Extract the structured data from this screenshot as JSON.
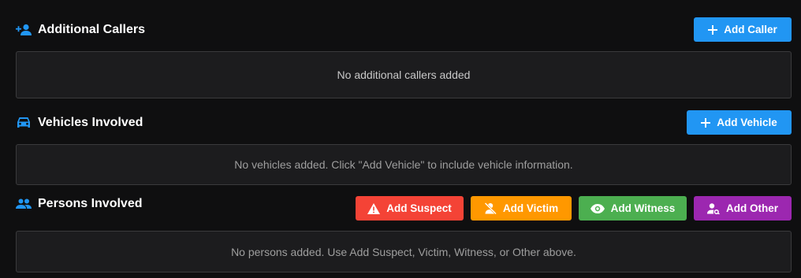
{
  "sections": {
    "callers": {
      "title": "Additional Callers",
      "icon": "person-add-icon",
      "button_label": "Add Caller",
      "empty_text": "No additional callers added"
    },
    "vehicles": {
      "title": "Vehicles Involved",
      "icon": "car-icon",
      "button_label": "Add Vehicle",
      "empty_text": "No vehicles added. Click \"Add Vehicle\" to include vehicle information."
    },
    "persons": {
      "title": "Persons Involved",
      "icon": "people-icon",
      "buttons": {
        "suspect": "Add Suspect",
        "victim": "Add Victim",
        "witness": "Add Witness",
        "other": "Add Other"
      },
      "empty_text": "No persons added. Use Add Suspect, Victim, Witness, or Other above."
    }
  },
  "colors": {
    "accent_blue": "#2196f3",
    "suspect_red": "#f44336",
    "victim_orange": "#ff9800",
    "witness_green": "#4caf50",
    "other_purple": "#9c27b0",
    "background": "#0f0f10",
    "panel": "#1c1c1e"
  }
}
